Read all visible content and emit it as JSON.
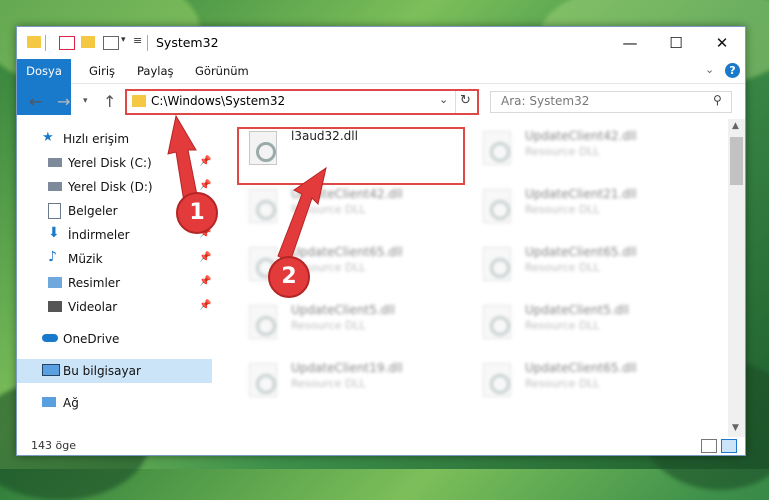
{
  "titlebar": {
    "title": "System32",
    "minimize": "—",
    "maximize": "☐",
    "close": "✕"
  },
  "ribbon": {
    "tabs": [
      "Dosya",
      "Giriş",
      "Paylaş",
      "Görünüm"
    ]
  },
  "address": {
    "path": "C:\\Windows\\System32"
  },
  "search": {
    "placeholder": "Ara: System32"
  },
  "nav": {
    "items": [
      {
        "label": "Hızlı erişim",
        "icon": "star-icon"
      },
      {
        "label": "Yerel Disk (C:)",
        "icon": "drive-icon"
      },
      {
        "label": "Yerel Disk (D:)",
        "icon": "drive-icon"
      },
      {
        "label": "Belgeler",
        "icon": "document-icon"
      },
      {
        "label": "İndirmeler",
        "icon": "download-icon"
      },
      {
        "label": "Müzik",
        "icon": "music-icon"
      },
      {
        "label": "Resimler",
        "icon": "pictures-icon"
      },
      {
        "label": "Videolar",
        "icon": "video-icon"
      },
      {
        "label": "OneDrive",
        "icon": "cloud-icon"
      },
      {
        "label": "Bu bilgisayar",
        "icon": "computer-icon"
      },
      {
        "label": "Ağ",
        "icon": "network-icon"
      }
    ]
  },
  "files": [
    {
      "name": "l3aud32.dll",
      "type": ""
    },
    {
      "name": "UpdateClient42.dll",
      "type": "Resource DLL"
    },
    {
      "name": "UpdateClient42.dll",
      "type": "Resource DLL"
    },
    {
      "name": "UpdateClient21.dll",
      "type": "Resource DLL"
    },
    {
      "name": "UpdateClient65.dll",
      "type": "Resource DLL"
    },
    {
      "name": "UpdateClient65.dll",
      "type": "Resource DLL"
    },
    {
      "name": "UpdateClient5.dll",
      "type": "Resource DLL"
    },
    {
      "name": "UpdateClient5.dll",
      "type": "Resource DLL"
    },
    {
      "name": "UpdateClient19.dll",
      "type": "Resource DLL"
    },
    {
      "name": "UpdateClient65.dll",
      "type": "Resource DLL"
    }
  ],
  "status": {
    "count": "143 öge"
  },
  "annotations": {
    "badge1": "1",
    "badge2": "2"
  },
  "colors": {
    "accent": "#1979ca",
    "highlight": "#e04848",
    "selected": "#cce4f7"
  }
}
